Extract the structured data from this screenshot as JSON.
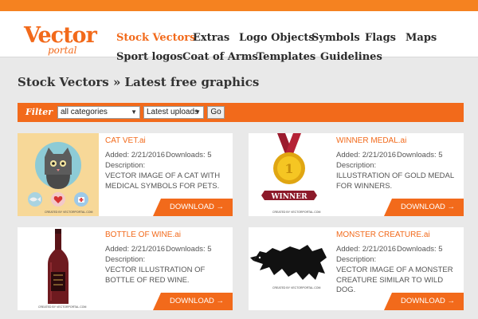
{
  "brand": {
    "logo_main": "Vector",
    "logo_sub": "portal",
    "accent_color": "#f26a1b"
  },
  "nav": {
    "row1": [
      "Stock Vectors",
      "Extras",
      "Logo Objects",
      "Symbols",
      "Flags",
      "Maps"
    ],
    "row2": [
      "Sport logos",
      "Coat of Arms",
      "Templates",
      "Guidelines"
    ],
    "active": "Stock Vectors"
  },
  "page_title": "Stock Vectors » Latest free graphics",
  "filter": {
    "label": "Filter",
    "category_value": "all categories",
    "sort_value": "Latest uploads",
    "go_label": "Go"
  },
  "cards": [
    {
      "title": "CAT VET.ai",
      "added": "Added: 2/21/2016",
      "downloads": "Downloads: 5",
      "desc_label": "Description:",
      "desc": "VECTOR IMAGE OF A CAT WITH MEDICAL SYMBOLS FOR PETS.",
      "download_label": "DOWNLOAD →",
      "credit": "CREATED BY VECTORPORTAL.COM"
    },
    {
      "title": "WINNER MEDAL.ai",
      "added": "Added: 2/21/2016",
      "downloads": "Downloads: 5",
      "desc_label": "Description:",
      "desc": "ILLUSTRATION OF GOLD MEDAL FOR WINNERS.",
      "download_label": "DOWNLOAD →",
      "credit": "CREATED BY VECTORPORTAL.COM",
      "medal_number": "1",
      "ribbon_text": "WINNER"
    },
    {
      "title": "BOTTLE OF WINE.ai",
      "added": "Added: 2/21/2016",
      "downloads": "Downloads: 5",
      "desc_label": "Description:",
      "desc": "VECTOR ILLUSTRATION OF BOTTLE OF RED WINE.",
      "download_label": "DOWNLOAD →",
      "credit": "CREATED BY VECTORPORTAL.COM"
    },
    {
      "title": "MONSTER CREATURE.ai",
      "added": "Added: 2/21/2016",
      "downloads": "Downloads: 5",
      "desc_label": "Description:",
      "desc": "VECTOR IMAGE OF A MONSTER CREATURE SIMILAR TO WILD DOG.",
      "download_label": "DOWNLOAD →",
      "credit": "CREATED BY VECTORPORTAL.COM"
    }
  ]
}
